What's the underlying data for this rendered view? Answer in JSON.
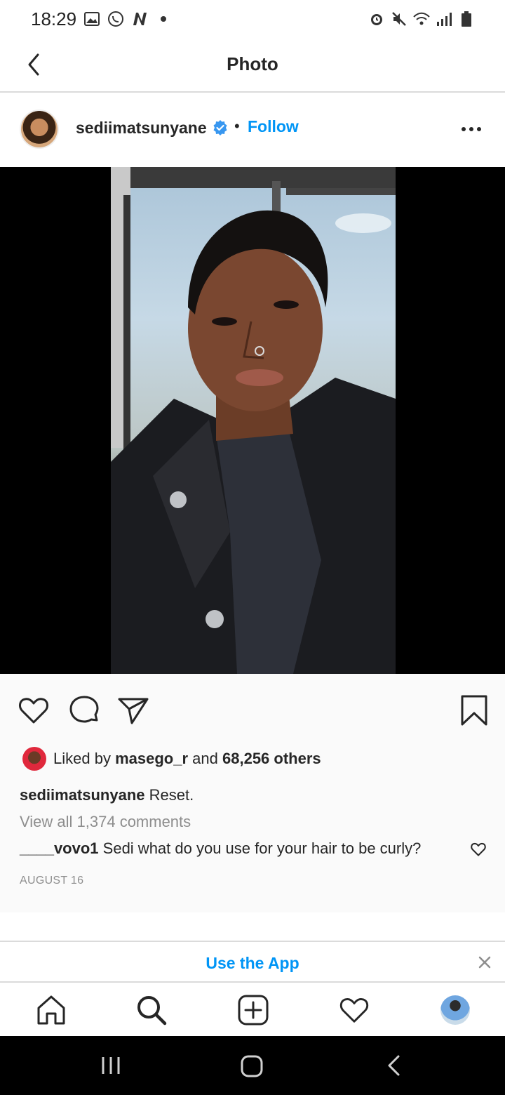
{
  "status_bar": {
    "time": "18:29",
    "left_icons": [
      "gallery-icon",
      "whatsapp-icon",
      "n-app-icon",
      "dot-icon"
    ],
    "right_icons": [
      "alarm-icon",
      "mute-icon",
      "wifi-icon",
      "signal-icon",
      "battery-icon"
    ]
  },
  "app_bar": {
    "title": "Photo",
    "back_icon": "chevron-left-icon"
  },
  "post": {
    "username": "sediimatsunyane",
    "separator": "•",
    "follow_label": "Follow",
    "more_icon": "more-horizontal-icon",
    "likes": {
      "prefix": "Liked by",
      "user": "masego_r",
      "conjunction": "and",
      "others": "68,256 others"
    },
    "caption": {
      "username": "sediimatsunyane",
      "text": "Reset."
    },
    "view_all_comments": "View all 1,374 comments",
    "comment": {
      "username": "____vovo1",
      "text": "Sedi what do you use for your hair to be curly?"
    },
    "date": "AUGUST 16"
  },
  "banner": {
    "label": "Use the App",
    "close_icon": "close-icon"
  },
  "bottom_nav": {
    "items": [
      "home-icon",
      "search-icon",
      "new-post-icon",
      "activity-heart-icon",
      "profile-avatar"
    ]
  },
  "colors": {
    "link_blue": "#0095f6",
    "text": "#262626",
    "muted": "#8e8e8e",
    "divider": "#dbdbdb"
  }
}
